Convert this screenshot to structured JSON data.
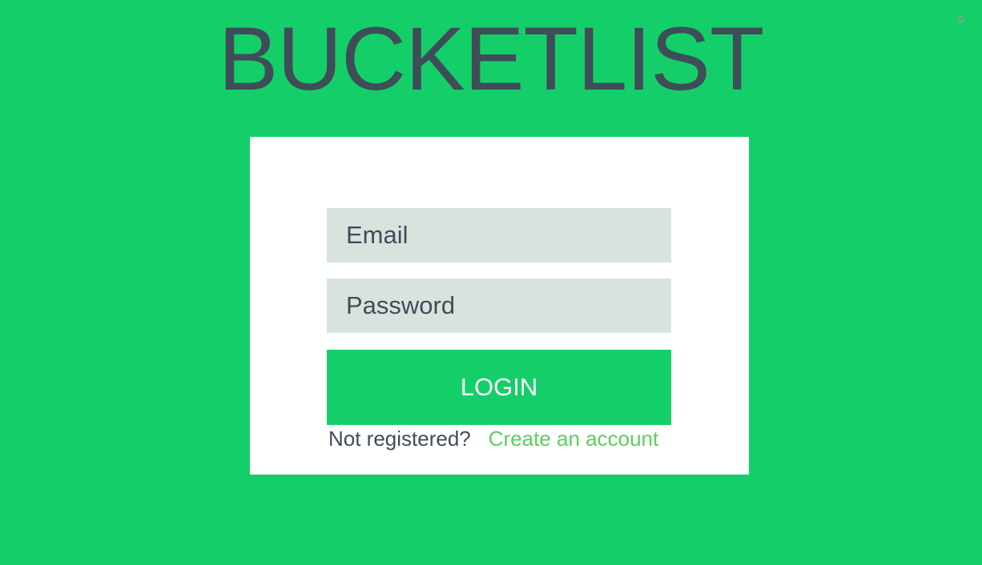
{
  "app": {
    "title": "BUCKETLIST"
  },
  "login_form": {
    "email_placeholder": "Email",
    "password_placeholder": "Password",
    "login_button_label": "LOGIN",
    "not_registered_text": "Not registered?",
    "create_account_link": "Create an account"
  },
  "colors": {
    "background": "#14cf69",
    "card": "#ffffff",
    "input_background": "#d9e3de",
    "text": "#3f4d58",
    "link": "#5ccf5e"
  },
  "icons": {
    "corner": "settings-dot-icon"
  }
}
